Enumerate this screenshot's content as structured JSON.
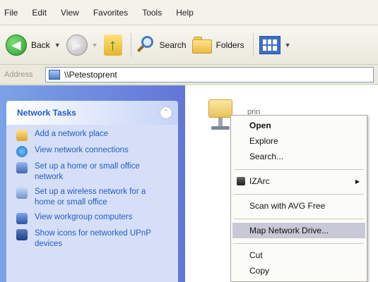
{
  "menubar": {
    "items": [
      "File",
      "Edit",
      "View",
      "Favorites",
      "Tools",
      "Help"
    ]
  },
  "toolbar": {
    "back_label": "Back",
    "search_label": "Search",
    "folders_label": "Folders"
  },
  "address": {
    "label": "Address",
    "value": "\\\\Petestoprent"
  },
  "tasks_panel": {
    "title": "Network Tasks",
    "items": [
      {
        "label": "Add a network place",
        "icon": "network-place-icon"
      },
      {
        "label": "View network connections",
        "icon": "network-connections-icon"
      },
      {
        "label": "Set up a home or small office network",
        "icon": "home-network-icon"
      },
      {
        "label": "Set up a wireless network for a home or small office",
        "icon": "wireless-network-icon"
      },
      {
        "label": "View workgroup computers",
        "icon": "workgroup-icon"
      },
      {
        "label": "Show icons for networked UPnP devices",
        "icon": "upnp-icon"
      }
    ]
  },
  "share": {
    "name": "prin"
  },
  "context_menu": {
    "open": "Open",
    "explore": "Explore",
    "search": "Search...",
    "izarc": "IZArc",
    "scan": "Scan with AVG Free",
    "map_drive": "Map Network Drive...",
    "cut": "Cut",
    "copy": "Copy"
  },
  "colors": {
    "task_link": "#215dc6",
    "panel_gradient_start": "#7ba2e7",
    "panel_gradient_end": "#6375d6",
    "menu_highlight": "#c9c8d6"
  }
}
